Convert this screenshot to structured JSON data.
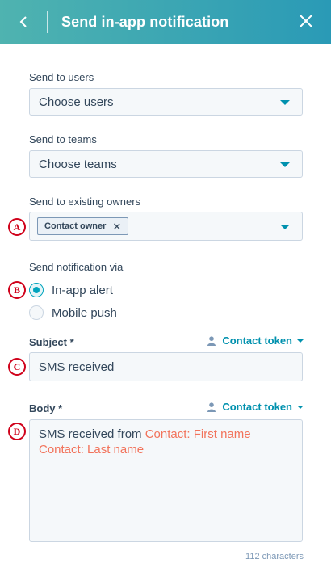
{
  "header": {
    "title": "Send in-app notification",
    "back_icon": "chevron-left-icon",
    "close_icon": "close-icon"
  },
  "fields": {
    "users": {
      "label": "Send to users",
      "placeholder": "Choose users"
    },
    "teams": {
      "label": "Send to teams",
      "placeholder": "Choose teams"
    },
    "owners": {
      "label": "Send to existing owners",
      "tags": [
        "Contact owner"
      ]
    },
    "notify_via": {
      "label": "Send notification via",
      "options": [
        {
          "label": "In-app alert",
          "selected": true
        },
        {
          "label": "Mobile push",
          "selected": false
        }
      ]
    },
    "subject": {
      "label": "Subject *",
      "value": "SMS received",
      "token_button": "Contact token"
    },
    "body": {
      "label": "Body *",
      "token_button": "Contact token",
      "text": "SMS received from",
      "tokens": [
        "Contact: First name",
        "Contact: Last name"
      ],
      "char_count": "112 characters"
    }
  },
  "markers": [
    "A",
    "B",
    "C",
    "D"
  ],
  "colors": {
    "header_start": "#4fb3b0",
    "header_end": "#2a9ab6",
    "accent": "#0091ae",
    "token": "#f2735b",
    "marker": "#d0021b"
  }
}
